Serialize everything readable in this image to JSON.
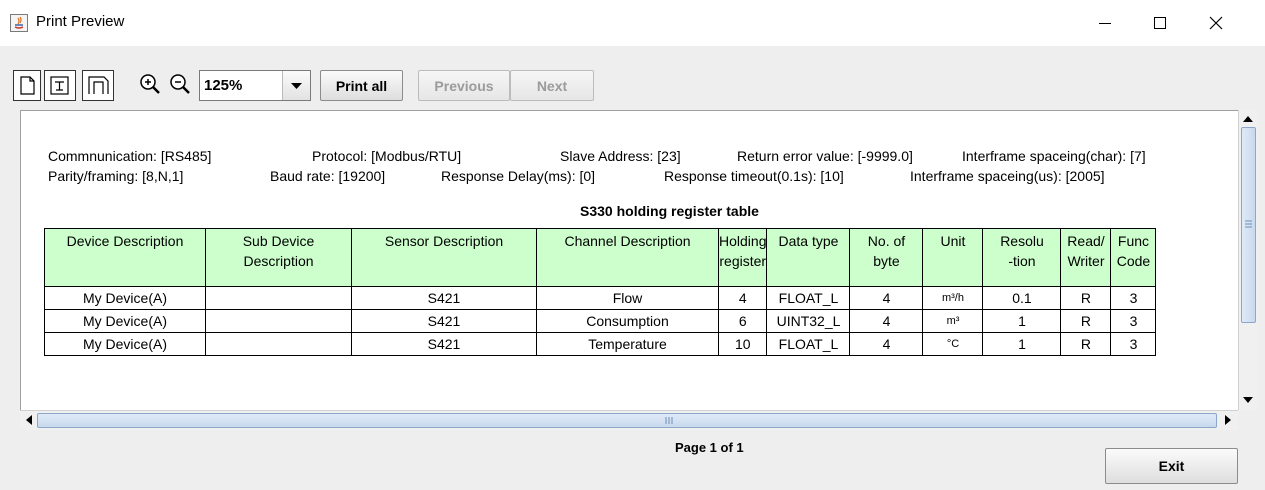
{
  "window": {
    "title": "Print Preview"
  },
  "toolbar": {
    "zoom_value": "125%",
    "print_all_label": "Print all",
    "previous_label": "Previous",
    "next_label": "Next"
  },
  "info": {
    "line1": {
      "communication": "Commnunication: [RS485]",
      "protocol": "Protocol: [Modbus/RTU]",
      "slave_address": "Slave Address: [23]",
      "return_error": "Return error value: [-9999.0]",
      "interframe_char": "Interframe spaceing(char): [7]"
    },
    "line2": {
      "parity": "Parity/framing: [8,N,1]",
      "baud": "Baud rate: [19200]",
      "response_delay": "Response Delay(ms): [0]",
      "response_timeout": "Response timeout(0.1s): [10]",
      "interframe_us": "Interframe spaceing(us): [2005]"
    }
  },
  "table": {
    "title": "S330 holding register table",
    "headers": [
      [
        "Device Description"
      ],
      [
        "Sub Device",
        "Description"
      ],
      [
        "Sensor Description"
      ],
      [
        "Channel Description"
      ],
      [
        "Holding",
        "register"
      ],
      [
        "Data type"
      ],
      [
        "No. of",
        "byte"
      ],
      [
        "Unit"
      ],
      [
        "Resolu",
        "-tion"
      ],
      [
        "Read/",
        "Writer"
      ],
      [
        "Func",
        "Code"
      ]
    ],
    "rows": [
      [
        "My Device(A)",
        "",
        "S421",
        "Flow",
        "4",
        "FLOAT_L",
        "4",
        "m³/h",
        "0.1",
        "R",
        "3"
      ],
      [
        "My Device(A)",
        "",
        "S421",
        "Consumption",
        "6",
        "UINT32_L",
        "4",
        "m³",
        "1",
        "R",
        "3"
      ],
      [
        "My Device(A)",
        "",
        "S421",
        "Temperature",
        "10",
        "FLOAT_L",
        "4",
        "°C",
        "1",
        "R",
        "3"
      ]
    ]
  },
  "footer": {
    "page_label": "Page 1 of 1",
    "exit_label": "Exit"
  },
  "icons": [
    "java-app-icon",
    "minimize-icon",
    "maximize-icon",
    "close-icon",
    "portrait-page-icon",
    "landscape-page-icon",
    "page-setup-icon",
    "zoom-in-icon",
    "zoom-out-icon",
    "dropdown-arrow-icon"
  ]
}
